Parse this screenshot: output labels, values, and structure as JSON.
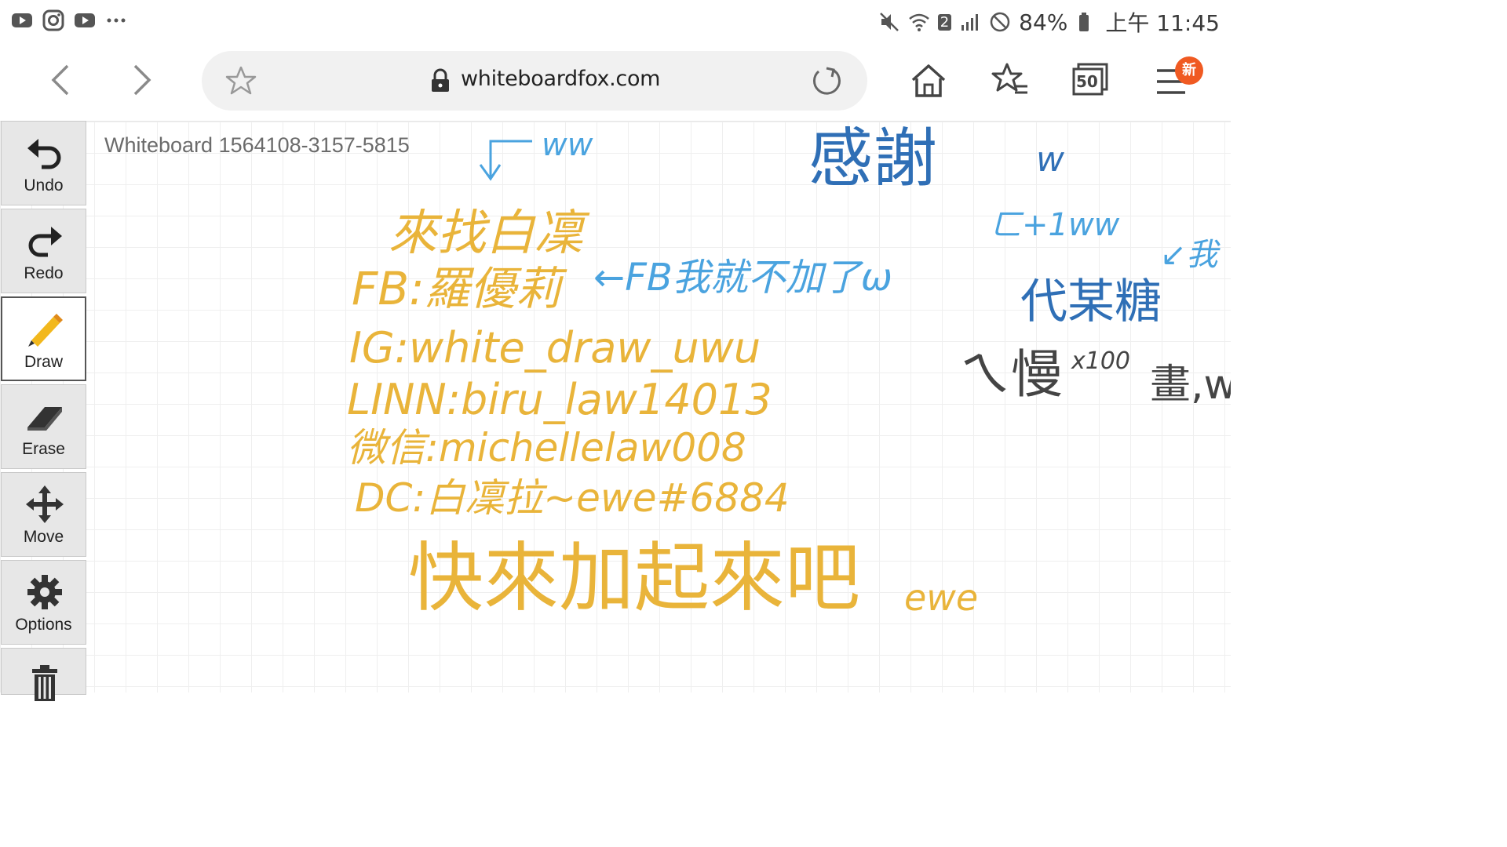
{
  "status_bar": {
    "left_icons": [
      "youtube-icon",
      "instagram-icon",
      "youtube-icon",
      "more-dots-icon"
    ],
    "battery": "84%",
    "time": "上午 11:45",
    "wifi_badge": "2"
  },
  "browser": {
    "url": "whiteboardfox.com",
    "new_badge": "新",
    "tabs_count": "50"
  },
  "board": {
    "title": "Whiteboard 1564108-3157-5815"
  },
  "toolbar": {
    "items": [
      {
        "label": "Undo",
        "icon": "undo-icon"
      },
      {
        "label": "Redo",
        "icon": "redo-icon"
      },
      {
        "label": "Draw",
        "icon": "pencil-icon"
      },
      {
        "label": "Erase",
        "icon": "eraser-icon"
      },
      {
        "label": "Move",
        "icon": "move-icon"
      },
      {
        "label": "Options",
        "icon": "gear-icon"
      },
      {
        "label": "",
        "icon": "trash-icon"
      }
    ]
  },
  "handwriting": {
    "orange": [
      "來找白凜",
      "FB:羅優莉",
      "IG:white_draw_uwu",
      "LINN:biru_law14013",
      "微信:michellelaw008",
      "DC:白凜拉~ewe#6884",
      "快來加起來吧",
      "ewe"
    ],
    "blue": [
      "ww",
      "←FB我就不加了ω",
      "感謝",
      "w",
      "ㄈ+1ww",
      "代某糖",
      "↙我",
      "ㄟ慢",
      "x100",
      "畫,w"
    ]
  },
  "colors": {
    "orange_ink": "#e9b43a",
    "blue_ink": "#4aa3df",
    "dark_blue_ink": "#2f6fb6",
    "toolbar_bg": "#e7e7e7",
    "new_badge": "#f05a22"
  }
}
